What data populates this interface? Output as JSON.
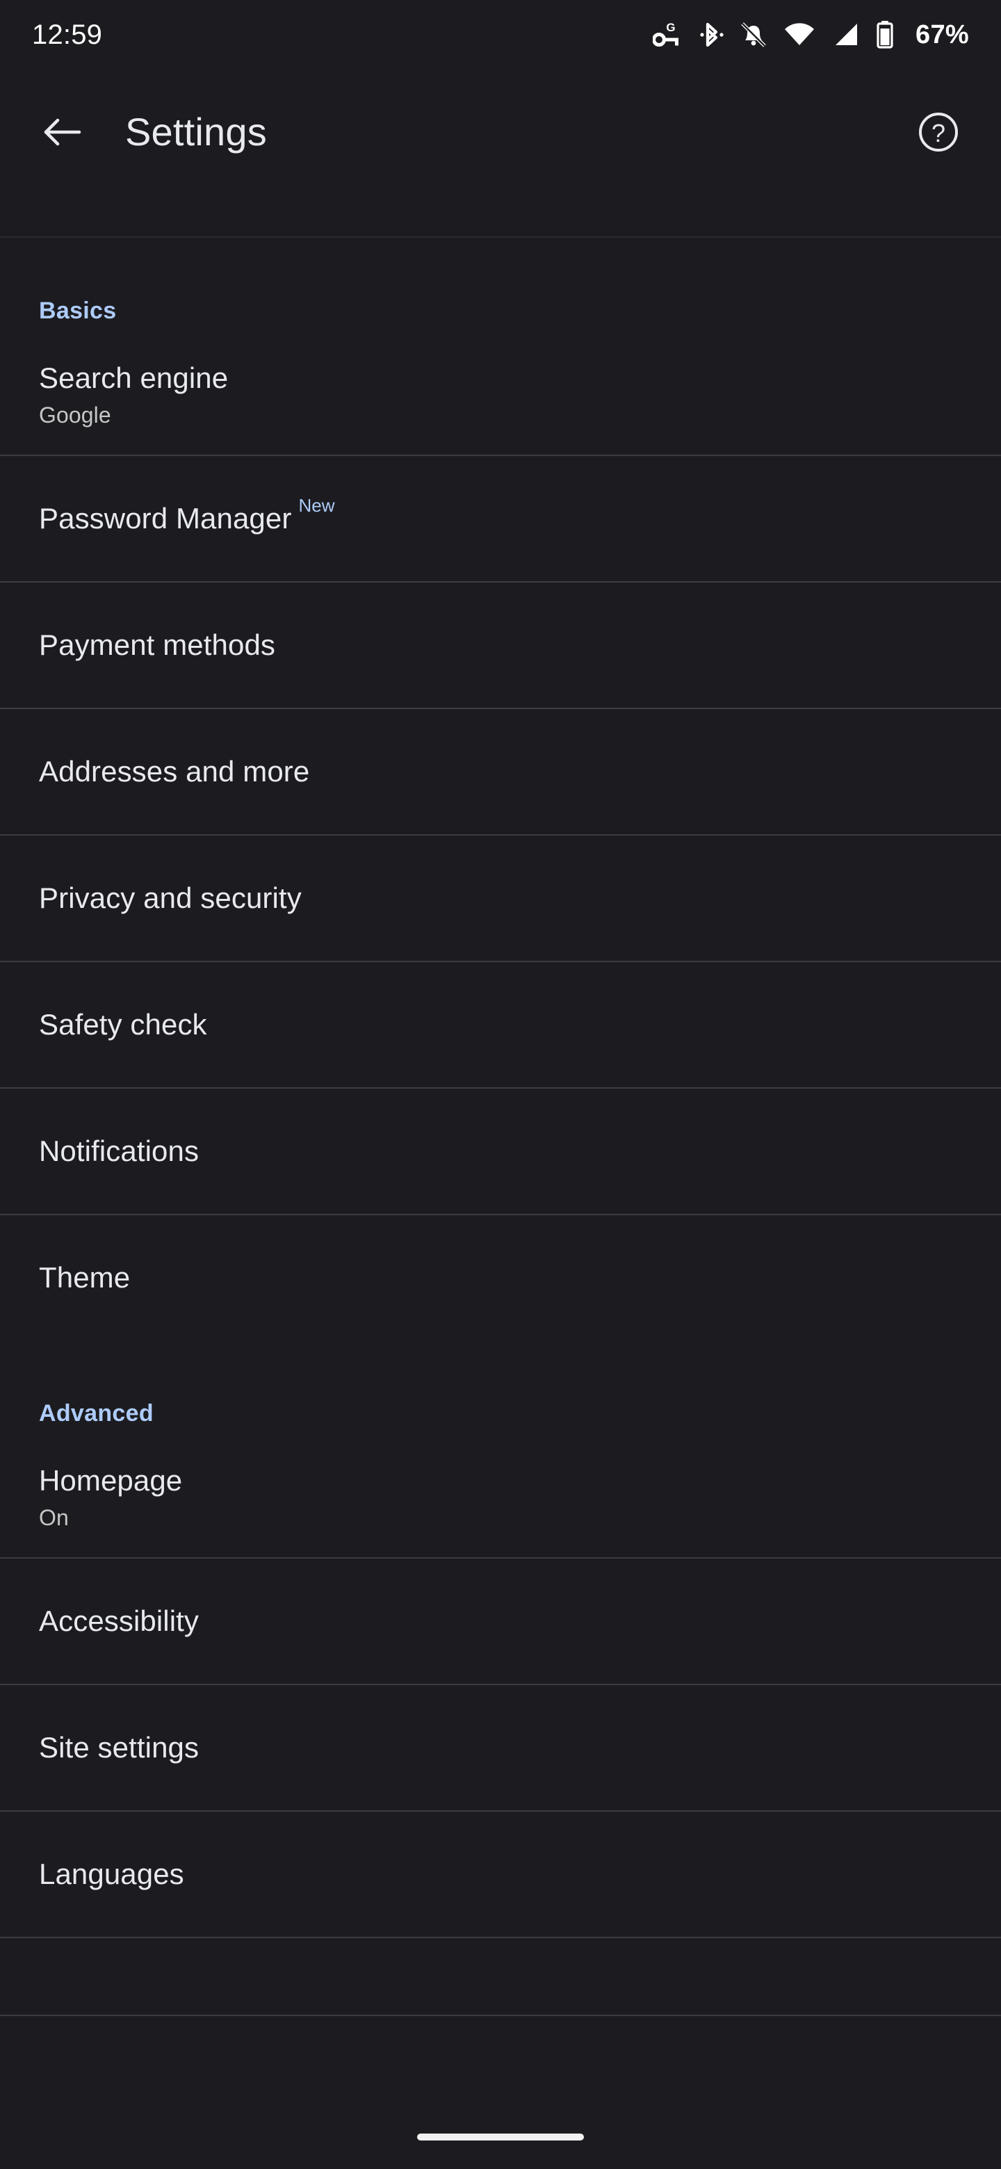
{
  "status_bar": {
    "clock": "12:59",
    "battery_percent": "67%",
    "icons": [
      "google-password-key-icon",
      "bluetooth-icon",
      "notifications-muted-icon",
      "wifi-icon",
      "cellular-signal-icon",
      "battery-icon"
    ]
  },
  "app_bar": {
    "back_label": "Back",
    "title": "Settings",
    "help_label": "Help & feedback"
  },
  "colors": {
    "background": "#1c1c20",
    "section_header_accent": "#aecbfa",
    "primary_text": "#e8eaed",
    "secondary_text": "#c4c7c5",
    "divider": "#3b3b43",
    "badge": "#aecbfa"
  },
  "sections": [
    {
      "header": "Basics",
      "items": [
        {
          "title": "Search engine",
          "subtitle": "Google",
          "badge": ""
        },
        {
          "title": "Password Manager",
          "subtitle": "",
          "badge": "New"
        },
        {
          "title": "Payment methods",
          "subtitle": "",
          "badge": ""
        },
        {
          "title": "Addresses and more",
          "subtitle": "",
          "badge": ""
        },
        {
          "title": "Privacy and security",
          "subtitle": "",
          "badge": ""
        },
        {
          "title": "Safety check",
          "subtitle": "",
          "badge": ""
        },
        {
          "title": "Notifications",
          "subtitle": "",
          "badge": ""
        },
        {
          "title": "Theme",
          "subtitle": "",
          "badge": ""
        }
      ]
    },
    {
      "header": "Advanced",
      "items": [
        {
          "title": "Homepage",
          "subtitle": "On",
          "badge": ""
        },
        {
          "title": "Accessibility",
          "subtitle": "",
          "badge": ""
        },
        {
          "title": "Site settings",
          "subtitle": "",
          "badge": ""
        },
        {
          "title": "Languages",
          "subtitle": "",
          "badge": ""
        }
      ]
    }
  ],
  "nav_bar": {
    "gesture_pill_label": "Home gesture bar"
  }
}
